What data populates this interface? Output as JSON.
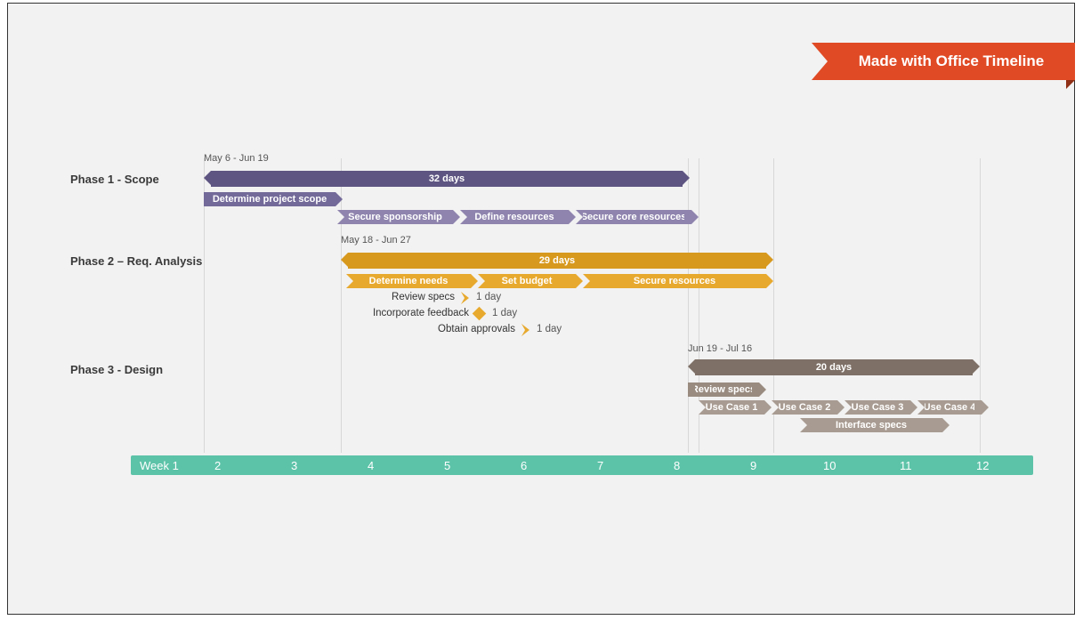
{
  "ribbon": {
    "label": "Made with Office Timeline"
  },
  "axis": {
    "first_label": "Week 1",
    "labels": [
      "2",
      "3",
      "4",
      "5",
      "6",
      "7",
      "8",
      "9",
      "10",
      "11",
      "12"
    ]
  },
  "phase1": {
    "label": "Phase 1 - Scope",
    "daterange": "May 6 - Jun 19",
    "summary": "32 days",
    "tasks": {
      "scope": "Determine project scope",
      "sponsor": "Secure sponsorship",
      "define": "Define resources",
      "secure": "Secure core resources"
    }
  },
  "phase2": {
    "label": "Phase 2 – Req. Analysis",
    "daterange": "May 18 - Jun 27",
    "summary": "29 days",
    "tasks": {
      "needs": "Determine needs",
      "budget": "Set budget",
      "secure": "Secure resources",
      "review": "Review specs",
      "review_dur": "1 day",
      "feedback": "Incorporate feedback",
      "feedback_dur": "1 day",
      "approvals": "Obtain approvals",
      "approvals_dur": "1 day"
    }
  },
  "phase3": {
    "label": "Phase 3 - Design",
    "daterange": "Jun 19 - Jul 16",
    "summary": "20 days",
    "tasks": {
      "review": "Review specs",
      "uc1": "Use Case 1",
      "uc2": "Use Case 2",
      "uc3": "Use Case 3",
      "uc4": "Use Case 4",
      "interface": "Interface specs"
    }
  },
  "chart_data": {
    "type": "gantt",
    "x_unit": "week",
    "xlim": [
      1,
      12
    ],
    "phases": [
      {
        "name": "Phase 1 - Scope",
        "daterange": "May 6 - Jun 19",
        "duration_days": 32,
        "span_weeks": [
          1,
          8
        ],
        "color": "#5e5582",
        "tasks": [
          {
            "name": "Determine project scope",
            "span_weeks": [
              1.0,
              2.9
            ],
            "color": "#746a9a"
          },
          {
            "name": "Secure sponsorship",
            "span_weeks": [
              2.9,
              4.5
            ],
            "color": "#8e84ad"
          },
          {
            "name": "Define resources",
            "span_weeks": [
              4.5,
              6.1
            ],
            "color": "#8e84ad"
          },
          {
            "name": "Secure core resources",
            "span_weeks": [
              6.1,
              8.0
            ],
            "color": "#8e84ad"
          }
        ]
      },
      {
        "name": "Phase 2 – Req. Analysis",
        "daterange": "May 18 - Jun 27",
        "duration_days": 29,
        "span_weeks": [
          2.9,
          9.0
        ],
        "color": "#d89a1e",
        "tasks": [
          {
            "name": "Determine needs",
            "span_weeks": [
              3.0,
              4.8
            ],
            "color": "#e8aa2e"
          },
          {
            "name": "Set budget",
            "span_weeks": [
              4.8,
              6.2
            ],
            "color": "#e8aa2e"
          },
          {
            "name": "Secure resources",
            "span_weeks": [
              6.2,
              9.0
            ],
            "color": "#e8aa2e"
          },
          {
            "name": "Review specs",
            "milestone_week": 4.6,
            "duration_label": "1 day",
            "color": "#e8aa2e"
          },
          {
            "name": "Incorporate feedback",
            "milestone_week": 4.8,
            "duration_label": "1 day",
            "color": "#e8aa2e"
          },
          {
            "name": "Obtain approvals",
            "milestone_week": 5.5,
            "duration_label": "1 day",
            "color": "#e8aa2e"
          }
        ]
      },
      {
        "name": "Phase 3 - Design",
        "daterange": "Jun 19 - Jul 16",
        "duration_days": 20,
        "span_weeks": [
          8.0,
          12.0
        ],
        "color": "#7e7066",
        "tasks": [
          {
            "name": "Review specs",
            "span_weeks": [
              8.0,
              8.9
            ],
            "color": "#998b80"
          },
          {
            "name": "Use Case 1",
            "span_weeks": [
              8.15,
              9.1
            ],
            "color": "#a89b91"
          },
          {
            "name": "Use Case 2",
            "span_weeks": [
              9.1,
              10.0
            ],
            "color": "#a89b91"
          },
          {
            "name": "Use Case 3",
            "span_weeks": [
              10.0,
              10.9
            ],
            "color": "#a89b91"
          },
          {
            "name": "Use Case 4",
            "span_weeks": [
              10.9,
              11.8
            ],
            "color": "#a89b91"
          },
          {
            "name": "Interface specs",
            "span_weeks": [
              9.5,
              11.5
            ],
            "color": "#a89b91"
          }
        ]
      }
    ]
  }
}
